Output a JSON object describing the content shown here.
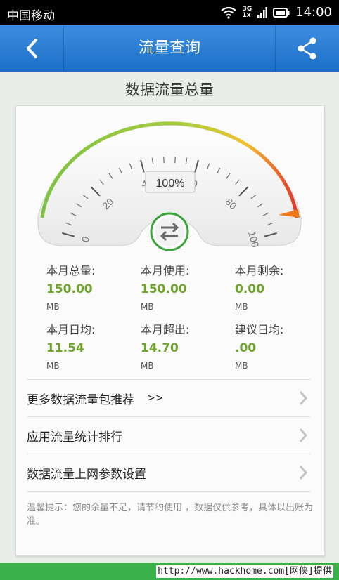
{
  "status_bar": {
    "carrier": "中国移动",
    "network_top": "3G",
    "network_bottom": "1x",
    "time": "14:00"
  },
  "app_bar": {
    "title": "流量查询",
    "back_icon": "chevron-left-icon",
    "share_icon": "share-icon"
  },
  "page_title": "数据流量总量",
  "gauge": {
    "ticks": [
      "0",
      "20",
      "40",
      "60",
      "80",
      "100"
    ],
    "percent_label": "100%",
    "level_percent": 100,
    "swap_icon": "swap-arrows-icon",
    "colors": {
      "green": "#7cc242",
      "yellow": "#f2c331",
      "red": "#e2342a",
      "swap_ring": "#3aa43a"
    }
  },
  "stats": [
    {
      "label": "本月总量:",
      "value": "150.00",
      "unit": "MB"
    },
    {
      "label": "本月使用:",
      "value": "150.00",
      "unit": "MB"
    },
    {
      "label": "本月剩余:",
      "value": "0.00",
      "unit": "MB"
    },
    {
      "label": "本月日均:",
      "value": "11.54",
      "unit": "MB"
    },
    {
      "label": "本月超出:",
      "value": "14.70",
      "unit": "MB"
    },
    {
      "label": "建议日均:",
      "value": ".00",
      "unit": "MB"
    }
  ],
  "menu": [
    {
      "label": "更多数据流量包推荐",
      "suffix": ">>"
    },
    {
      "label": "应用流量统计排行",
      "suffix": ""
    },
    {
      "label": "数据流量上网参数设置",
      "suffix": ""
    }
  ],
  "tip": "温馨提示：您的余量不足，请节约使用 ，数据仅供参考，具体以出账为准。",
  "watermark": "http://www.hackhome.com[网侠]提供"
}
